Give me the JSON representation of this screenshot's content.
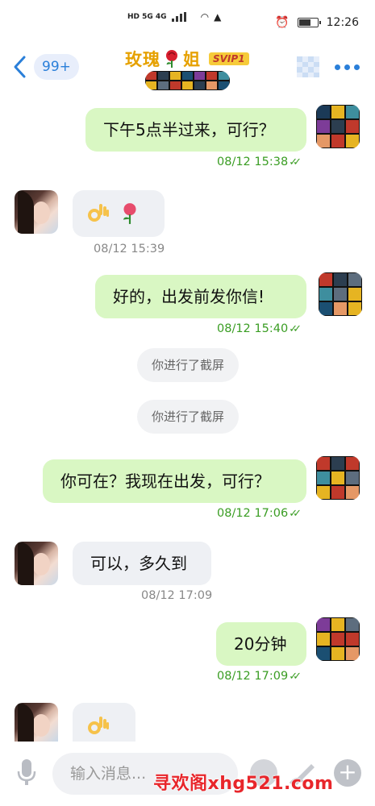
{
  "status_bar": {
    "network_left": "HD 5G 4G",
    "time": "12:26"
  },
  "header": {
    "unread_count": "99+",
    "contact_name_1": "玫瑰",
    "contact_name_2": "姐",
    "badge": "SVIP1"
  },
  "messages": [
    {
      "text": "下午5点半过来，可行？",
      "time": "08/12 15:38"
    },
    {
      "text": "",
      "time": "08/12 15:39"
    },
    {
      "text": "好的，出发前发你信!",
      "time": "08/12 15:40"
    },
    {
      "text": "你进行了截屏"
    },
    {
      "text": "你进行了截屏"
    },
    {
      "text": "你可在？我现在出发，可行？",
      "time": "08/12 17:06"
    },
    {
      "text": "可以，多久到",
      "time": "08/12 17:09"
    },
    {
      "text": "20分钟",
      "time": "08/12 17:09"
    },
    {
      "text": ""
    }
  ],
  "input": {
    "placeholder": "输入消息..."
  },
  "watermark": "寻欢阁xhg521.com",
  "colors": {
    "accent": "#2a7fd9",
    "outgoing_bubble": "#d9f7c3",
    "incoming_bubble": "#eef0f4",
    "read_green": "#3a9d23"
  },
  "icons": [
    "back-icon",
    "more-icon",
    "mic-icon",
    "emoji-icon",
    "pen-icon",
    "plus-icon",
    "ok-hand-icon",
    "rose-icon"
  ]
}
